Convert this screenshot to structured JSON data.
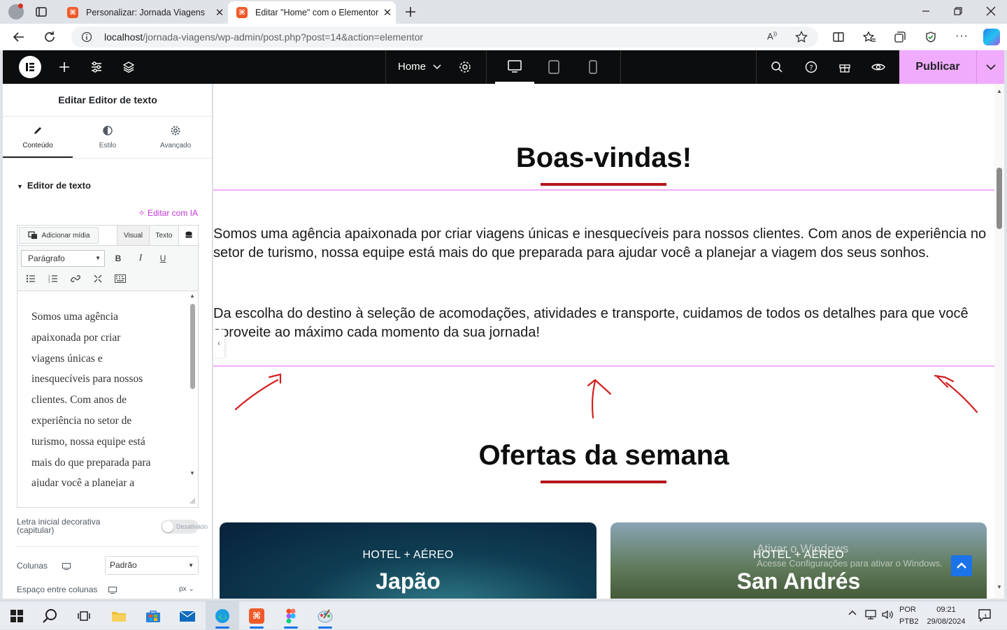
{
  "browser": {
    "tabs": [
      {
        "title": "Personalizar: Jornada Viagens",
        "active": false
      },
      {
        "title": "Editar \"Home\" com o Elementor",
        "active": true
      }
    ],
    "url": {
      "host": "localhost",
      "path": "/jornada-viagens/wp-admin/post.php?post=14&action=elementor"
    }
  },
  "topbar": {
    "page_selector": "Home",
    "publish_label": "Publicar"
  },
  "panel": {
    "title": "Editar Editor de texto",
    "tabs": [
      "Conteúdo",
      "Estilo",
      "Avançado"
    ],
    "section": "Editor de texto",
    "ai_edit": "Editar com IA",
    "add_media": "Adicionar mídia",
    "editor_tabs": [
      "Visual",
      "Texto"
    ],
    "format": "Parágrafo",
    "editor_lines": [
      "Somos uma agência",
      "apaixonada por criar",
      "viagens únicas e",
      "inesquecíveis para nossos",
      "clientes. Com anos de",
      "experiência no setor de",
      "turismo, nossa equipe está",
      "mais do que preparada para",
      "ajudar você a planejar a"
    ],
    "dropcap_label": "Letra inicial decorativa (capitular)",
    "dropcap_state": "Desativado",
    "columns_label": "Colunas",
    "columns_value": "Padrão",
    "gap_label": "Espaço entre colunas",
    "gap_unit": "px"
  },
  "canvas": {
    "welcome_title": "Boas-vindas!",
    "paragraph1": "Somos uma agência apaixonada por criar viagens únicas e inesquecíveis para nossos clientes. Com anos de experiência no setor de turismo, nossa equipe está mais do que preparada para ajudar você a planejar a viagem dos seus sonhos.",
    "paragraph2": "Da escolha do destino à seleção de acomodações, atividades e transporte, cuidamos de todos os detalhes para que você aproveite ao máximo cada momento da sua jornada!",
    "offers_title": "Ofertas da semana",
    "cards": [
      {
        "kicker": "HOTEL + AÉREO",
        "name": "Japão"
      },
      {
        "kicker": "HOTEL + AÉREO",
        "name": "San Andrés"
      }
    ],
    "watermark": {
      "line1": "Ativar o Windows",
      "line2": "Acesse Configurações para ativar o Windows."
    }
  },
  "taskbar": {
    "lang": "POR",
    "layout": "PTB2",
    "time": "09:21",
    "date": "29/08/2024",
    "notifications": "1"
  },
  "colors": {
    "accent_pink": "#f0abfc",
    "underline_red": "#b4161b",
    "elementor_dark": "#0c0d0e"
  }
}
